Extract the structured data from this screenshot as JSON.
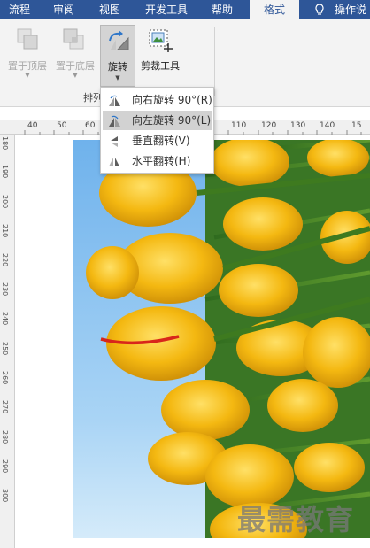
{
  "tabs": [
    {
      "label": "流程",
      "active": false
    },
    {
      "label": "审阅",
      "active": false
    },
    {
      "label": "视图",
      "active": false
    },
    {
      "label": "开发工具",
      "active": false
    },
    {
      "label": "帮助",
      "active": false
    },
    {
      "label": "格式",
      "active": true
    },
    {
      "label": "操作说",
      "active": false
    }
  ],
  "ribbon": {
    "bring_front": "置于顶层",
    "send_back": "置于底层",
    "rotate": "旋转",
    "crop": "剪裁工具",
    "group_label": "排列"
  },
  "rotate_menu": [
    {
      "label": "向右旋转 90°(R)",
      "icon": "rotate-right-icon"
    },
    {
      "label": "向左旋转 90°(L)",
      "icon": "rotate-left-icon"
    },
    {
      "label": "垂直翻转(V)",
      "icon": "flip-vertical-icon"
    },
    {
      "label": "水平翻转(H)",
      "icon": "flip-horizontal-icon"
    }
  ],
  "ruler_top": [
    "40",
    "50",
    "60",
    "110",
    "120",
    "130",
    "140",
    "15"
  ],
  "ruler_left": [
    "180",
    "190",
    "200",
    "210",
    "220",
    "230",
    "240",
    "250",
    "260",
    "270",
    "280",
    "290",
    "300"
  ],
  "watermark": "最需教育",
  "colors": {
    "tabbar": "#2e5698",
    "ribbon": "#f3f3f3",
    "sky": "#8cc4f0",
    "tulip": "#f2b716"
  }
}
